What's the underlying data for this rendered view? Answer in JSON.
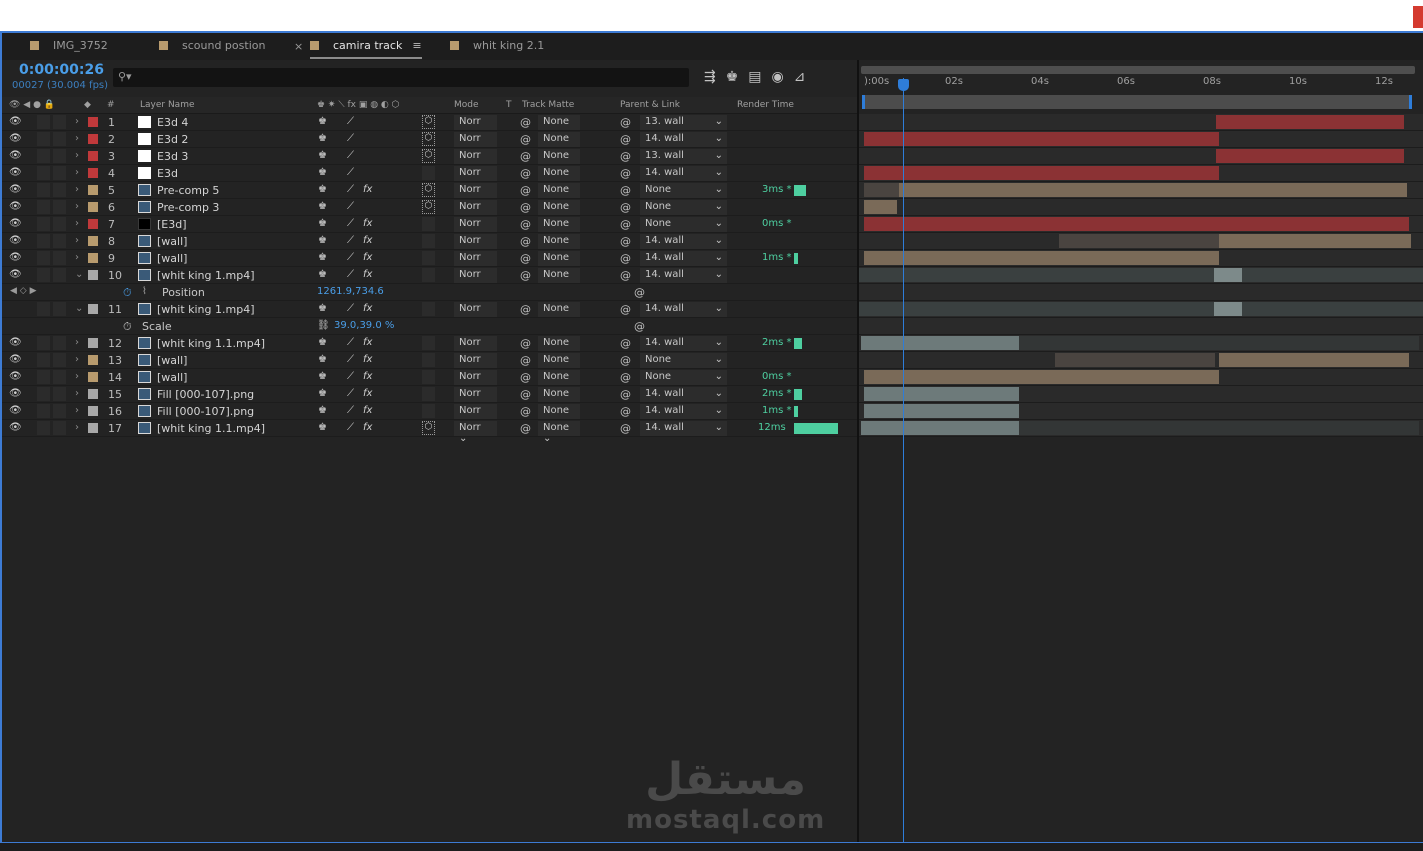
{
  "tabs": [
    {
      "label": "IMG_3752",
      "active": false
    },
    {
      "label": "scound postion",
      "active": false
    },
    {
      "label": "camira track",
      "active": true
    },
    {
      "label": "whit king 2.1",
      "active": false
    }
  ],
  "tab_close_glyph": "×",
  "tab_menu_glyph": "≡",
  "timecode": "0:00:00:26",
  "fps_info": "00027 (30.004 fps)",
  "search_placeholder": "⚲▾",
  "header": {
    "layer_name": "Layer Name",
    "hash": "#",
    "mode": "Mode",
    "t": "T",
    "track_matte": "Track Matte",
    "parent_link": "Parent & Link",
    "render_time": "Render Time"
  },
  "ruler": [
    "):00s",
    "02s",
    "04s",
    "06s",
    "08s",
    "10s",
    "12s"
  ],
  "colors": {
    "accent": "#2e7dd9",
    "red_label": "#c0393b",
    "tan_label": "#b89b6e",
    "gray_label": "#a8a8a8",
    "render_bar": "#4ecfa0"
  },
  "layers": [
    {
      "num": "1",
      "name": "E3d 4",
      "label": "red",
      "icon": "solid-white",
      "mode": "Norr",
      "tm": "None",
      "parent": "13. wall",
      "render": "",
      "fx": false,
      "has3d": true
    },
    {
      "num": "2",
      "name": "E3d 2",
      "label": "red",
      "icon": "solid-white",
      "mode": "Norr",
      "tm": "None",
      "parent": "14. wall",
      "render": "",
      "fx": false,
      "has3d": true
    },
    {
      "num": "3",
      "name": "E3d 3",
      "label": "red",
      "icon": "solid-white",
      "mode": "Norr",
      "tm": "None",
      "parent": "13. wall",
      "render": "",
      "fx": false,
      "has3d": true
    },
    {
      "num": "4",
      "name": "E3d",
      "label": "red",
      "icon": "solid-white",
      "mode": "Norr",
      "tm": "None",
      "parent": "14. wall",
      "render": "",
      "fx": false,
      "has3d": false
    },
    {
      "num": "5",
      "name": "Pre-comp 5",
      "label": "tan",
      "icon": "precomp",
      "mode": "Norr",
      "tm": "None",
      "parent": "None",
      "render": "3ms *",
      "fx": true,
      "has3d": true
    },
    {
      "num": "6",
      "name": "Pre-comp 3",
      "label": "tan",
      "icon": "precomp",
      "mode": "Norr",
      "tm": "None",
      "parent": "None",
      "render": "",
      "fx": false,
      "has3d": true
    },
    {
      "num": "7",
      "name": "[E3d]",
      "label": "red",
      "icon": "solid-black",
      "mode": "Norr",
      "tm": "None",
      "parent": "None",
      "render": "0ms *",
      "fx": true,
      "has3d": false
    },
    {
      "num": "8",
      "name": "[wall]",
      "label": "tan",
      "icon": "precomp",
      "mode": "Norr",
      "tm": "None",
      "parent": "14. wall",
      "render": "",
      "fx": true,
      "has3d": false
    },
    {
      "num": "9",
      "name": "[wall]",
      "label": "tan",
      "icon": "precomp",
      "mode": "Norr",
      "tm": "None",
      "parent": "14. wall",
      "render": "1ms *",
      "fx": true,
      "has3d": false
    },
    {
      "num": "10",
      "name": "[whit king 1.mp4]",
      "label": "gray",
      "icon": "footage",
      "mode": "Norr",
      "tm": "None",
      "parent": "14. wall",
      "render": "",
      "fx": true,
      "has3d": false,
      "expanded": true
    },
    {
      "prop": true,
      "name": "Position",
      "value": "1261.9,734.6"
    },
    {
      "num": "11",
      "name": "[whit king 1.mp4]",
      "label": "gray",
      "icon": "footage",
      "mode": "Norr",
      "tm": "None",
      "parent": "14. wall",
      "render": "",
      "fx": true,
      "has3d": false,
      "expanded": true,
      "hideEye": true
    },
    {
      "prop": true,
      "name": "Scale",
      "value": "39.0,39.0 %"
    },
    {
      "num": "12",
      "name": "[whit king 1.1.mp4]",
      "label": "gray",
      "icon": "footage",
      "mode": "Norr",
      "tm": "None",
      "parent": "14. wall",
      "render": "2ms *",
      "fx": true,
      "has3d": false
    },
    {
      "num": "13",
      "name": "[wall]",
      "label": "tan",
      "icon": "precomp",
      "mode": "Norr",
      "tm": "None",
      "parent": "None",
      "render": "",
      "fx": true,
      "has3d": false
    },
    {
      "num": "14",
      "name": "[wall]",
      "label": "tan",
      "icon": "precomp",
      "mode": "Norr",
      "tm": "None",
      "parent": "None",
      "render": "0ms *",
      "fx": true,
      "has3d": false
    },
    {
      "num": "15",
      "name": "Fill [000-107].png",
      "label": "gray",
      "icon": "sequence",
      "mode": "Norr",
      "tm": "None",
      "parent": "14. wall",
      "render": "2ms *",
      "fx": true,
      "has3d": false
    },
    {
      "num": "16",
      "name": "Fill [000-107].png",
      "label": "gray",
      "icon": "sequence",
      "mode": "Norr",
      "tm": "None",
      "parent": "14. wall",
      "render": "1ms *",
      "fx": true,
      "has3d": false
    },
    {
      "num": "17",
      "name": "[whit king 1.1.mp4]",
      "label": "gray",
      "icon": "footage",
      "mode": "Norr",
      "tm": "None",
      "parent": "14. wall",
      "render": "12ms",
      "fx": true,
      "has3d": true
    }
  ],
  "watermark": {
    "arabic": "مستقل",
    "latin": "mostaql.com"
  }
}
